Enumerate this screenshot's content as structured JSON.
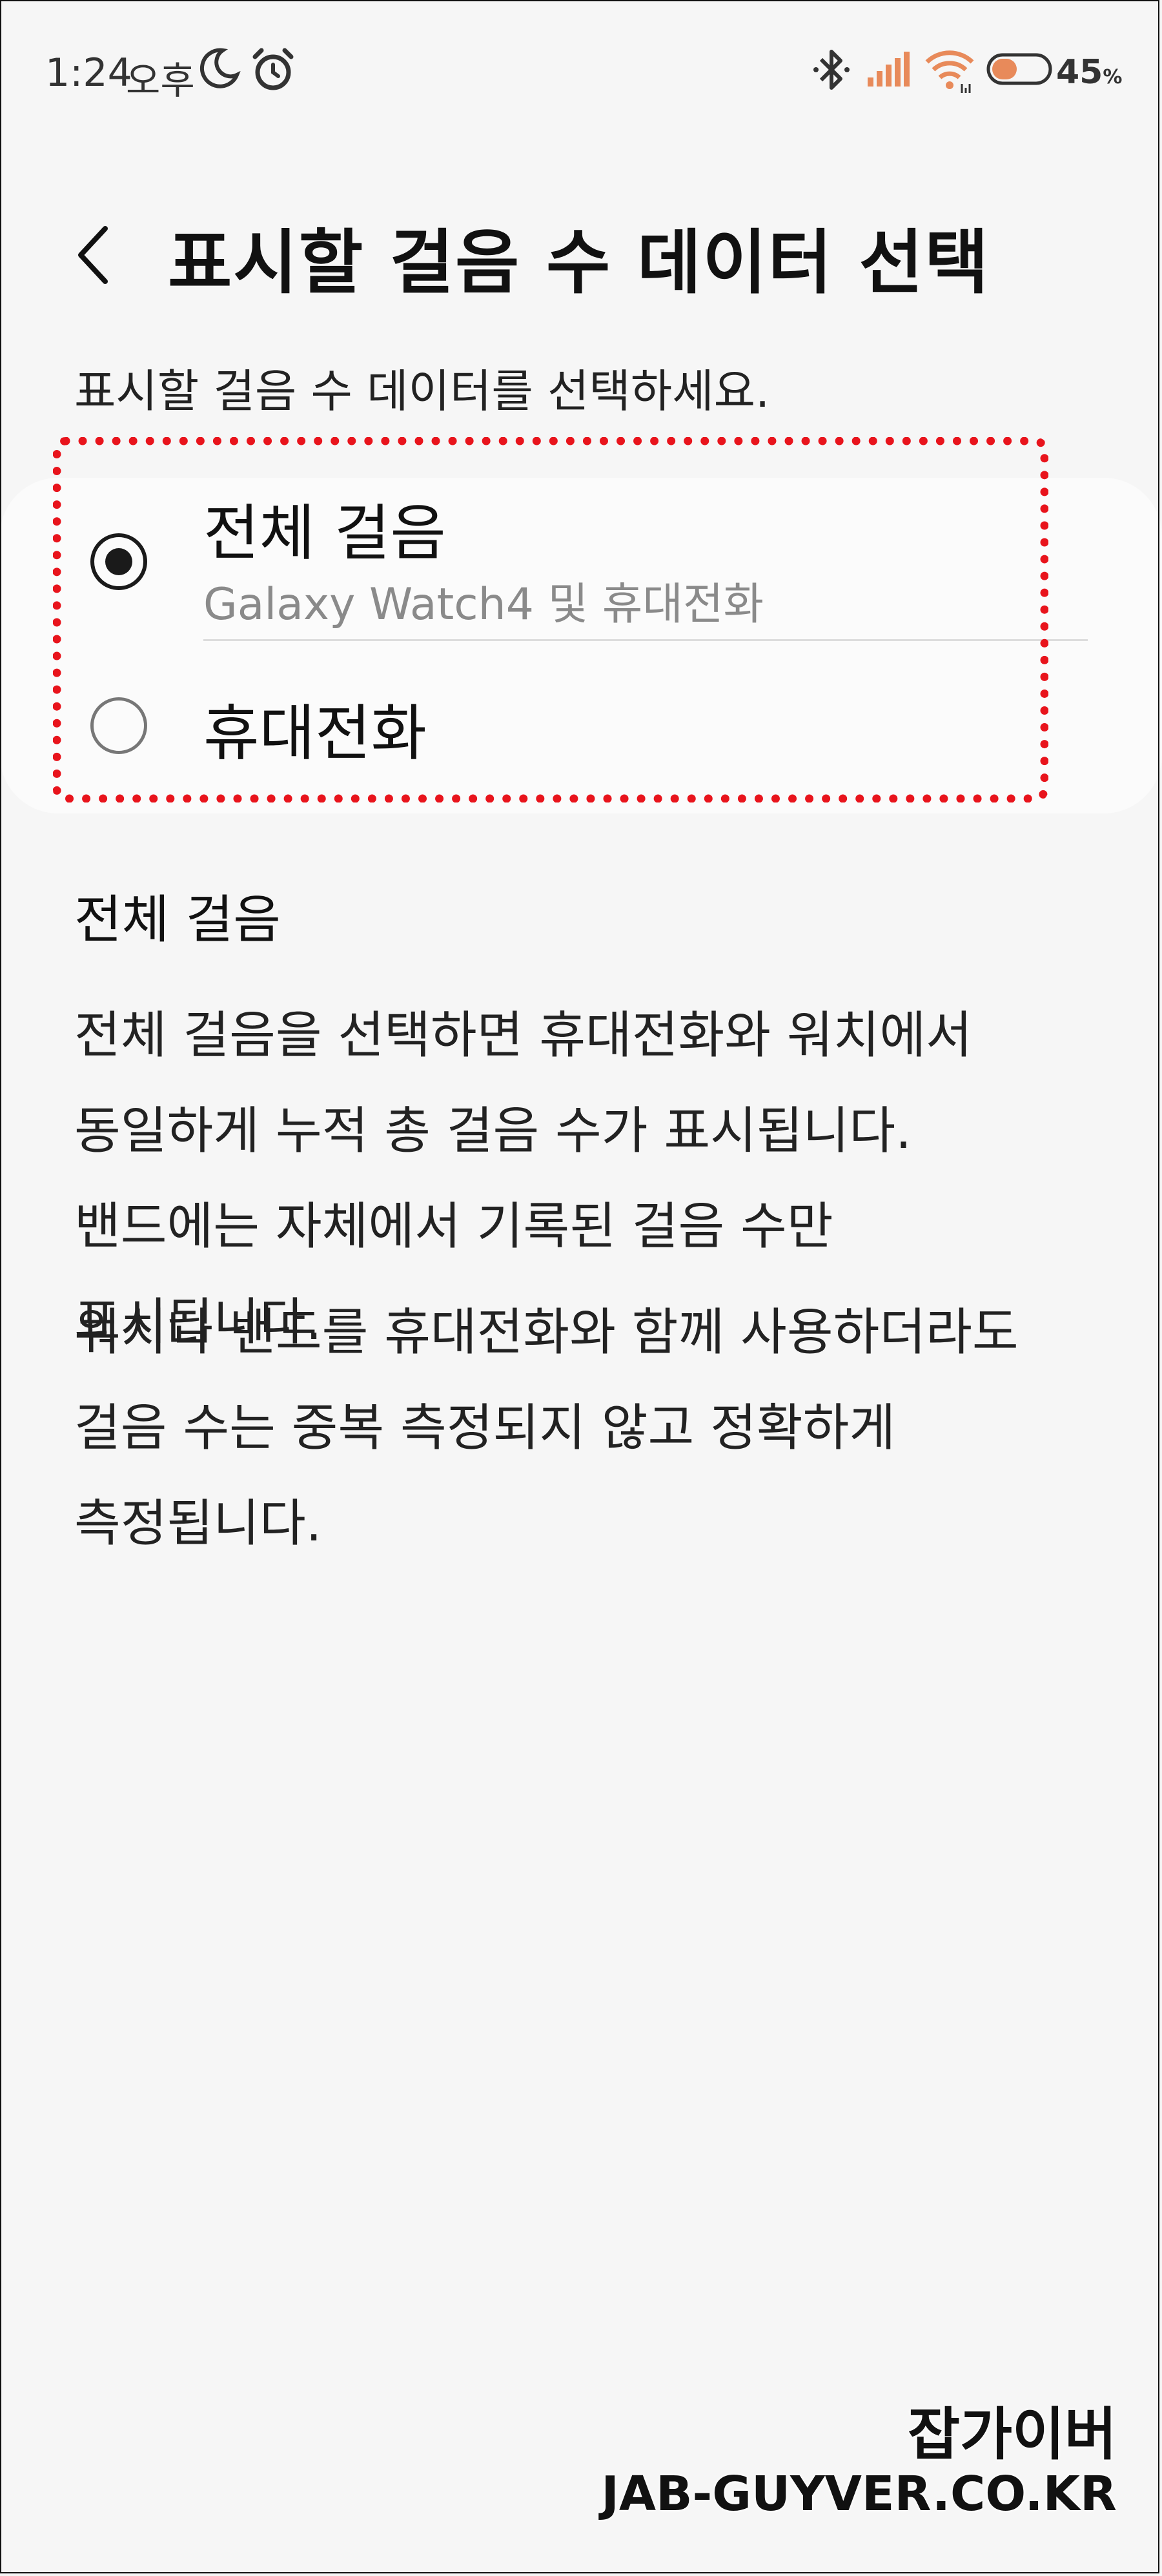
{
  "status_bar": {
    "time": "1:24",
    "ampm": "오후",
    "icons": [
      "moon-icon",
      "alarm-icon",
      "bluetooth-icon",
      "signal-icon",
      "wifi-icon",
      "battery-icon"
    ],
    "battery_percent": "45",
    "battery_unit": "%",
    "battery_level": 0.45
  },
  "header": {
    "title": "표시할 걸음 수 데이터 선택",
    "subtitle": "표시할 걸음 수 데이터를 선택하세요."
  },
  "options": [
    {
      "label": "전체 걸음",
      "sublabel": "Galaxy Watch4 및 휴대전화",
      "selected": true
    },
    {
      "label": "휴대전화",
      "selected": false
    }
  ],
  "description": {
    "heading": "전체 걸음",
    "paragraphs": [
      "전체 걸음을 선택하면 휴대전화와 워치에서 동일하게 누적 총 걸음 수가 표시됩니다. 밴드에는 자체에서 기록된 걸음 수만 표시됩니다.",
      "워치나 밴드를 휴대전화와 함께 사용하더라도 걸음 수는 중복 측정되지 않고 정확하게 측정됩니다."
    ]
  },
  "watermark": {
    "line1": "잡가이버",
    "line2": "JAB-GUYVER.CO.KR"
  },
  "colors": {
    "background": "#f6f6f6",
    "highlight": "#e8141c",
    "accent_orange": "#e88a5a"
  }
}
